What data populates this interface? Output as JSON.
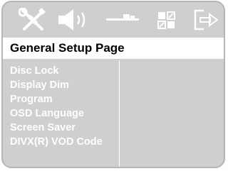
{
  "icons": [
    {
      "name": "tools-icon"
    },
    {
      "name": "speaker-icon"
    },
    {
      "name": "video-settings-icon"
    },
    {
      "name": "preference-icon"
    },
    {
      "name": "exit-icon"
    }
  ],
  "header": {
    "title": "General Setup Page"
  },
  "menu": {
    "items": [
      {
        "label": "Disc Lock"
      },
      {
        "label": "Display Dim"
      },
      {
        "label": "Program"
      },
      {
        "label": "OSD Language"
      },
      {
        "label": "Screen Saver"
      },
      {
        "label": "DIVX(R) VOD Code"
      }
    ]
  },
  "colors": {
    "background": "#cfcfcf",
    "header_bg": "#ffffff",
    "menu_text": "#ffffff",
    "header_text": "#000000"
  }
}
